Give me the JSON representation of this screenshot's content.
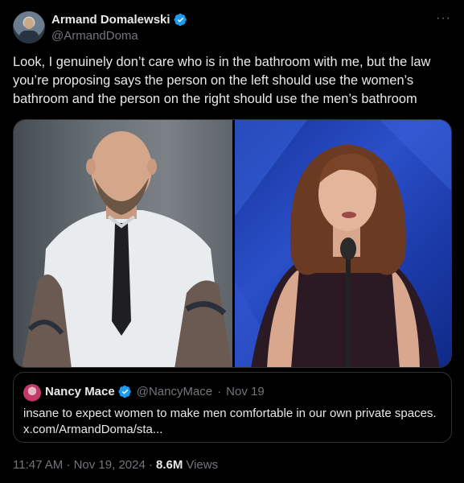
{
  "author": {
    "name": "Armand Domalewski",
    "handle": "@ArmandDoma"
  },
  "more_label": "···",
  "tweet_lines": [
    "Look, I genuinely don’t care who is in the bathroom with me, but the law",
    "you’re proposing says the person on the left should use the women’s",
    "bathroom and the person on the right should use the men’s bathroom"
  ],
  "quote": {
    "name": "Nancy Mace",
    "handle": "@NancyMace",
    "separator": "·",
    "date": "Nov 19",
    "text_line1": "insane to expect women to make men comfortable in our own private spaces.",
    "text_line2": "x.com/ArmandDoma/sta..."
  },
  "footer": {
    "timestamp": "11:47 AM · Nov 19, 2024 ·",
    "views_count": "8.6M",
    "views_label": "Views"
  },
  "colors": {
    "background": "#000000",
    "text": "#e7e9ea",
    "muted": "#71767b",
    "verified": "#1d9bf0",
    "border": "#2f3336"
  }
}
